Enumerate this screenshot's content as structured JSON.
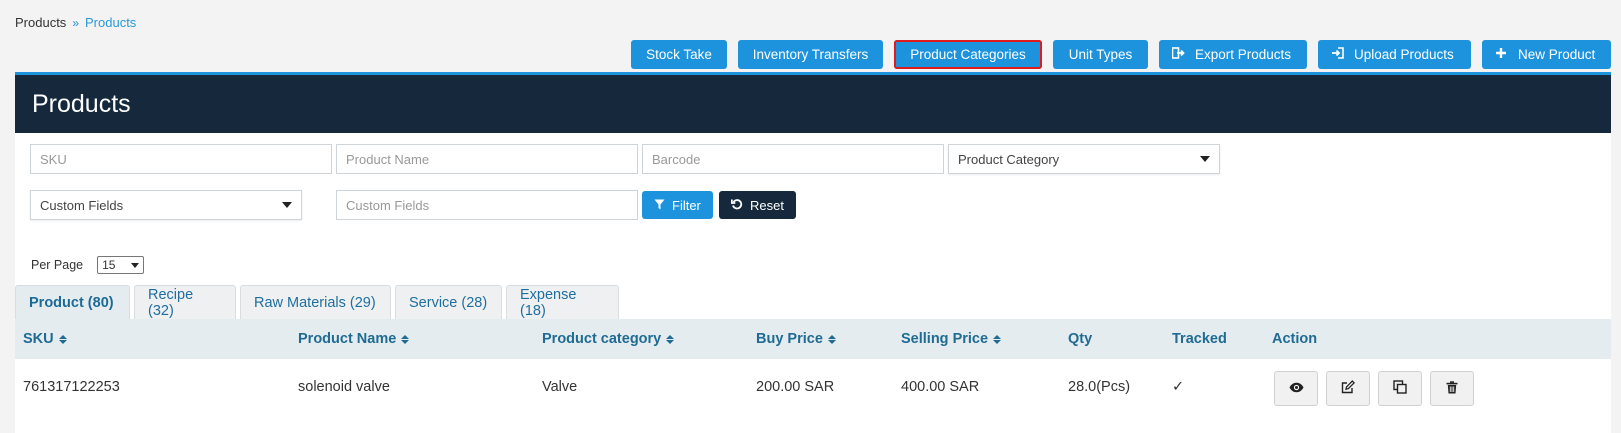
{
  "breadcrumb": {
    "root": "Products",
    "separator": "»",
    "current": "Products"
  },
  "top_actions": [
    {
      "label": "Stock Take",
      "icon": ""
    },
    {
      "label": "Inventory Transfers",
      "icon": ""
    },
    {
      "label": "Product Categories",
      "icon": ""
    },
    {
      "label": "Unit Types",
      "icon": ""
    },
    {
      "label": "Export Products",
      "icon": "export-icon"
    },
    {
      "label": "Upload Products",
      "icon": "upload-icon"
    },
    {
      "label": "New Product",
      "icon": "plus-icon"
    }
  ],
  "panel": {
    "title": "Products"
  },
  "filters": {
    "sku_placeholder": "SKU",
    "product_name_placeholder": "Product Name",
    "barcode_placeholder": "Barcode",
    "product_category": "Product Category",
    "custom_fields_select": "Custom Fields",
    "custom_fields_placeholder": "Custom Fields",
    "filter_label": "Filter",
    "reset_label": "Reset"
  },
  "per_page": {
    "label": "Per Page",
    "value": "15"
  },
  "tabs": [
    {
      "label": "Product (80)",
      "active": true
    },
    {
      "label": "Recipe (32)",
      "active": false
    },
    {
      "label": "Raw Materials (29)",
      "active": false
    },
    {
      "label": "Service (28)",
      "active": false
    },
    {
      "label": "Expense (18)",
      "active": false
    }
  ],
  "table": {
    "columns": [
      "SKU",
      "Product Name",
      "Product category",
      "Buy Price",
      "Selling Price",
      "Qty",
      "Tracked",
      "Action"
    ],
    "rows": [
      {
        "sku": "761317122253",
        "name": "solenoid valve",
        "category": "Valve",
        "buy": "200.00 SAR",
        "sell": "400.00 SAR",
        "qty": "28.0(Pcs)",
        "tracked": "✓"
      }
    ]
  },
  "colors": {
    "primary": "#1e93dd",
    "dark": "#16283c",
    "highlight": "#e01b1b"
  }
}
